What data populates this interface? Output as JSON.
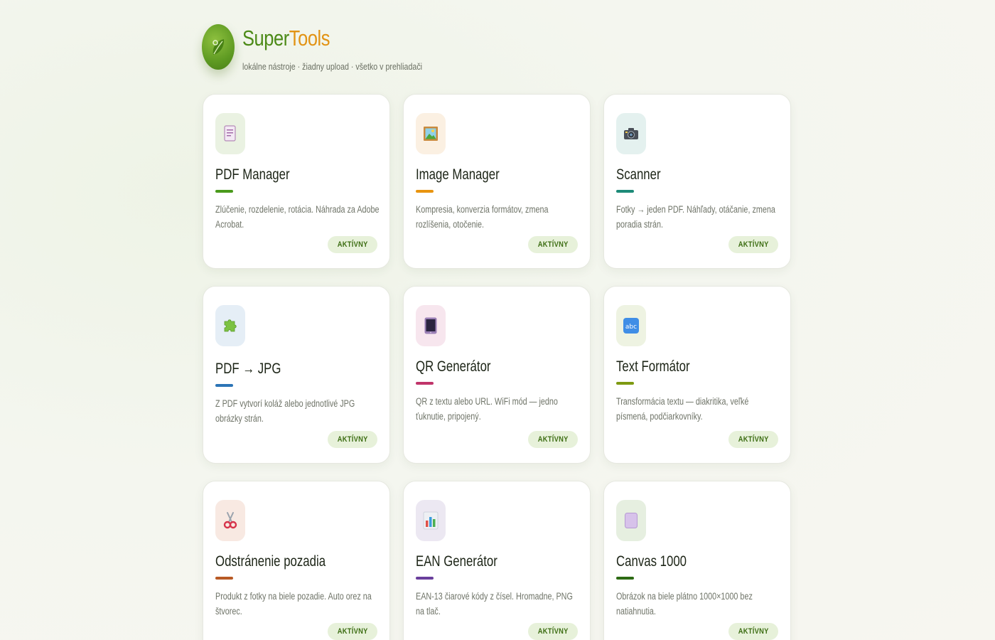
{
  "app": {
    "title_part1": "Super",
    "title_part2": "Tools",
    "subtitle": "lokálne nástroje · žiadny upload · všetko v prehliadači",
    "logo_icon": "leaf-icon"
  },
  "badge_label": "AKTÍVNY",
  "tools": [
    {
      "title": "PDF Manager",
      "description": "Zlúčenie, rozdelenie, rotácia. Náhrada za Adobe Acrobat.",
      "icon": "document-icon",
      "accent": "#4a9a1c",
      "icon_bg": "#eaf2e2"
    },
    {
      "title": "Image Manager",
      "description": "Kompresia, konverzia formátov, zmena rozlíšenia, otočenie.",
      "icon": "framed-picture-icon",
      "accent": "#e8940f",
      "icon_bg": "#fbf0e2"
    },
    {
      "title": "Scanner",
      "description": "Fotky → jeden PDF. Náhľady, otáčanie, zmena poradia strán.",
      "icon": "camera-icon",
      "accent": "#1d8a78",
      "icon_bg": "#e4f1ef"
    },
    {
      "title": "PDF → JPG",
      "description": "Z PDF vytvorí koláž alebo jednotlivé JPG obrázky strán.",
      "icon": "puzzle-icon",
      "accent": "#2c74b6",
      "icon_bg": "#e5eef6"
    },
    {
      "title": "QR Generátor",
      "description": "QR z textu alebo URL. WiFi mód — jedno ťuknutie, pripojený.",
      "icon": "tablet-icon",
      "accent": "#c0356a",
      "icon_bg": "#f7e6ee"
    },
    {
      "title": "Text Formátor",
      "description": "Transformácia textu — diakritika, veľké písmená, podčiarkovníky.",
      "icon": "abc-icon",
      "accent": "#7e9a12",
      "icon_bg": "#eef3e2"
    },
    {
      "title": "Odstránenie pozadia",
      "description": "Produkt z fotky na biele pozadie. Auto orez na štvorec.",
      "icon": "scissors-icon",
      "accent": "#b85a25",
      "icon_bg": "#f8e9e2"
    },
    {
      "title": "EAN Generátor",
      "description": "EAN-13 čiarové kódy z čísel. Hromadne, PNG na tlač.",
      "icon": "bar-chart-icon",
      "accent": "#6a3f9c",
      "icon_bg": "#ece8f2"
    },
    {
      "title": "Canvas 1000",
      "description": "Obrázok na biele plátno 1000×1000 bez natiahnutia.",
      "icon": "canvas-icon",
      "accent": "#2d6b14",
      "icon_bg": "#e6efe0"
    }
  ]
}
